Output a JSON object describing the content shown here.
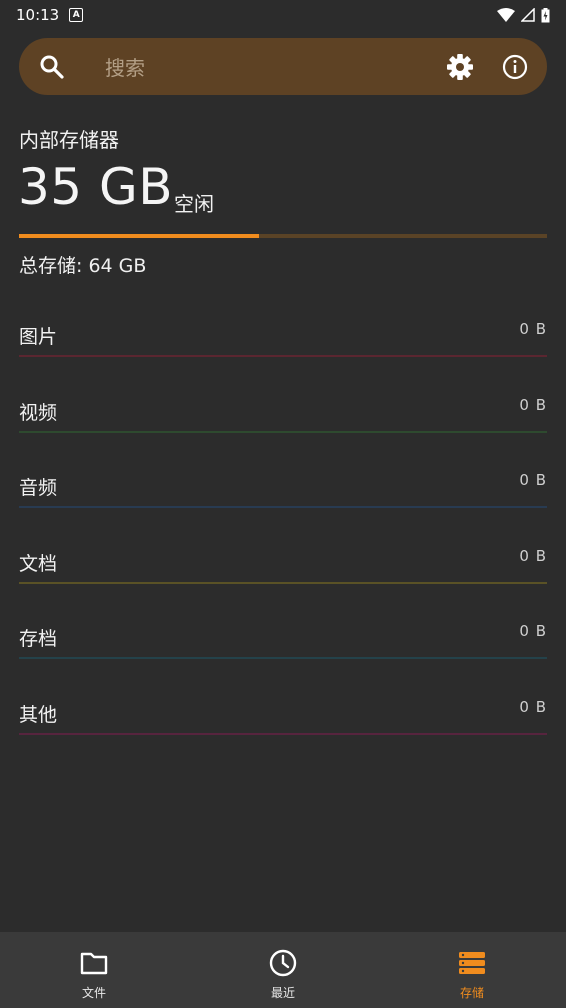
{
  "status_bar": {
    "time": "10:13",
    "notification_icon": "A"
  },
  "search": {
    "placeholder": "搜索"
  },
  "storage": {
    "title": "内部存储器",
    "free_amount": "35 GB",
    "free_label": "空闲",
    "used_fraction": 0.455,
    "total_text": "总存储: 64 GB",
    "accent_color": "#f08c1e"
  },
  "categories": [
    {
      "label": "图片",
      "size": "0 B",
      "color": "#5b2630"
    },
    {
      "label": "视频",
      "size": "0 B",
      "color": "#2e4a2f"
    },
    {
      "label": "音频",
      "size": "0 B",
      "color": "#283b52"
    },
    {
      "label": "文档",
      "size": "0 B",
      "color": "#5a5226"
    },
    {
      "label": "存档",
      "size": "0 B",
      "color": "#24424a"
    },
    {
      "label": "其他",
      "size": "0 B",
      "color": "#57243e"
    }
  ],
  "bottom_nav": {
    "items": [
      {
        "label": "文件",
        "icon": "folder-icon"
      },
      {
        "label": "最近",
        "icon": "clock-icon"
      },
      {
        "label": "存储",
        "icon": "storage-icon",
        "active": true
      }
    ]
  }
}
